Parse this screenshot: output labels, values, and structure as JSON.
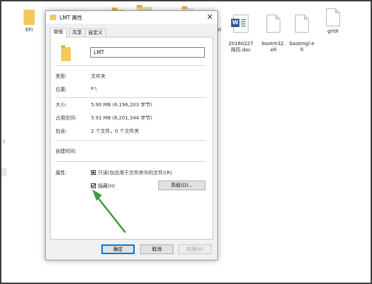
{
  "desktop": {
    "items": [
      {
        "label": "EFI",
        "type": "folder"
      },
      {
        "label": "bel",
        "type": "partial"
      },
      {
        "label": "20160227\n简历.doc",
        "type": "word"
      },
      {
        "label": "bootm32.\nefi",
        "type": "file"
      },
      {
        "label": "bootmgr.e\nfi",
        "type": "file"
      },
      {
        "label": "grldr",
        "type": "file"
      }
    ],
    "left_marks": [
      ":)"
    ]
  },
  "dialog": {
    "title": "LMT 属性",
    "close_glyph": "✕",
    "tabs": [
      "常规",
      "共享",
      "自定义"
    ],
    "active_tab": "常规",
    "name_value": "LMT",
    "rows": [
      {
        "label": "类型:",
        "value": "文件夹"
      },
      {
        "label": "位置:",
        "value": "F:\\"
      },
      {
        "label": "大小:",
        "value": "5.90 MB (6,196,203 字节)"
      },
      {
        "label": "占用空间:",
        "value": "5.91 MB (6,201,344 字节)"
      },
      {
        "label": "包含:",
        "value": "2 个文件，0 个文件夹"
      }
    ],
    "created_label": "创建时间:",
    "attributes_label": "属性:",
    "readonly_label": "只读(仅应用于文件夹中的文件)(R)",
    "hidden_label": "隐藏(H)",
    "advanced_button": "高级(D)...",
    "ok_button": "确定",
    "cancel_button": "取消",
    "apply_button": "应用(A)"
  },
  "colors": {
    "folder": "#f3c95a",
    "accent": "#0078d7",
    "arrow": "#3c9a3a"
  }
}
